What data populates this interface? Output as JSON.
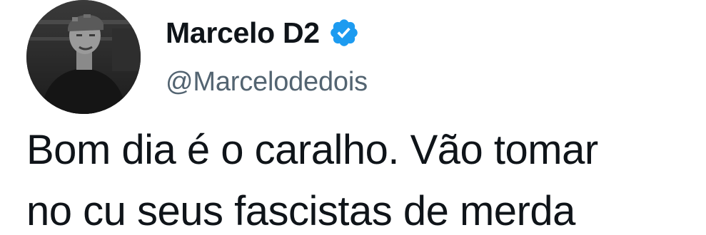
{
  "tweet": {
    "author": {
      "display_name": "Marcelo D2",
      "handle": "@Marcelodedois",
      "verified": true,
      "verified_icon": "verified-badge-icon",
      "avatar": "profile-photo"
    },
    "text_lines": [
      "Bom dia é o caralho. Vão tomar",
      "no cu seus fascistas de merda"
    ]
  },
  "colors": {
    "text_primary": "#0f1419",
    "text_secondary": "#536471",
    "verified_blue": "#1d9bf0",
    "background": "#ffffff"
  }
}
